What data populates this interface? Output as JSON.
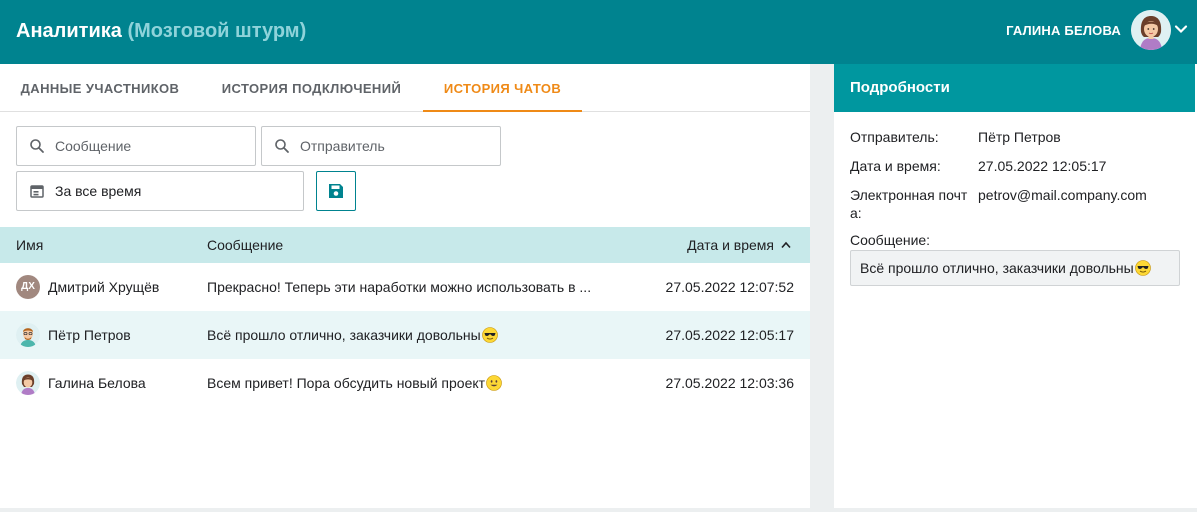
{
  "header": {
    "title": "Аналитика",
    "subtitle": "(Мозговой штурм)",
    "user_name": "ГАЛИНА БЕЛОВА",
    "accent_color": "#00838f"
  },
  "tabs": [
    {
      "label": "ДАННЫЕ УЧАСТНИКОВ",
      "active": false
    },
    {
      "label": "ИСТОРИЯ ПОДКЛЮЧЕНИЙ",
      "active": false
    },
    {
      "label": "ИСТОРИЯ ЧАТОВ",
      "active": true
    }
  ],
  "filters": {
    "message_placeholder": "Сообщение",
    "sender_placeholder": "Отправитель",
    "date_range": "За все время",
    "icons": {
      "search": "search-icon",
      "calendar": "calendar-icon",
      "save": "save-icon"
    }
  },
  "table": {
    "columns": {
      "name": "Имя",
      "message": "Сообщение",
      "date": "Дата и время"
    },
    "sort": {
      "column": "date",
      "direction": "ascending-arrow"
    },
    "rows": [
      {
        "avatar": "initials",
        "initials": "ДХ",
        "name": "Дмитрий Хрущёв",
        "message": "Прекрасно! Теперь эти наработки можно использовать в ...",
        "emoji": "",
        "date": "27.05.2022 12:07:52",
        "selected": false
      },
      {
        "avatar": "man-avatar",
        "initials": "",
        "name": "Пётр Петров",
        "message": "Всё прошло отлично, заказчики довольны",
        "emoji": "sunglasses-emoji",
        "date": "27.05.2022 12:05:17",
        "selected": true
      },
      {
        "avatar": "woman-avatar",
        "initials": "",
        "name": "Галина Белова",
        "message": "Всем привет! Пора обсудить новый проект",
        "emoji": "smile-emoji",
        "date": "27.05.2022 12:03:36",
        "selected": false
      }
    ]
  },
  "details": {
    "header": "Подробности",
    "sender_label": "Отправитель:",
    "sender_value": "Пётр Петров",
    "datetime_label": "Дата и время:",
    "datetime_value": "27.05.2022 12:05:17",
    "email_label": "Электронная почта:",
    "email_value": "petrov@mail.company.com",
    "message_label": "Сообщение:",
    "message_value": "Всё прошло отлично, заказчики довольны",
    "message_emoji": "sunglasses-emoji"
  }
}
